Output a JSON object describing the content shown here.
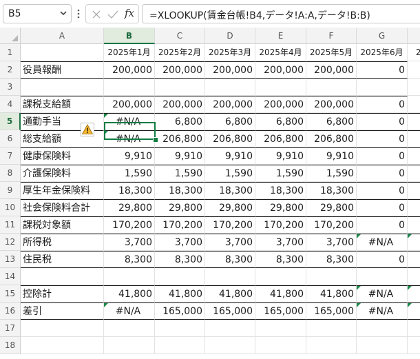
{
  "name_box": {
    "value": "B5"
  },
  "formula_bar": {
    "fx_label": "fx",
    "formula": "=XLOOKUP(賃金台帳!B4,データ!A:A,データ!B:B)"
  },
  "sheet": {
    "columns": [
      "A",
      "B",
      "C",
      "D",
      "E",
      "F",
      "G"
    ],
    "rows": [
      "1",
      "2",
      "3",
      "4",
      "5",
      "6",
      "7",
      "8",
      "9",
      "10",
      "11",
      "12",
      "13",
      "14",
      "15",
      "16",
      "17",
      "18"
    ],
    "header_row": [
      "",
      "2025年1月",
      "2025年2月",
      "2025年3月",
      "2025年4月",
      "2025年5月",
      "2025年6月",
      "20"
    ],
    "data": [
      [
        "役員報酬",
        "200,000",
        "200,000",
        "200,000",
        "200,000",
        "200,000",
        "0"
      ],
      [
        "",
        "",
        "",
        "",
        "",
        "",
        ""
      ],
      [
        "課税支給額",
        "200,000",
        "200,000",
        "200,000",
        "200,000",
        "200,000",
        "0"
      ],
      [
        "通勤手当",
        "#N/A",
        "6,800",
        "6,800",
        "6,800",
        "6,800",
        "0"
      ],
      [
        "総支給額",
        "#N/A",
        "206,800",
        "206,800",
        "206,800",
        "206,800",
        "0"
      ],
      [
        "健康保険料",
        "9,910",
        "9,910",
        "9,910",
        "9,910",
        "9,910",
        "0"
      ],
      [
        "介護保険料",
        "1,590",
        "1,590",
        "1,590",
        "1,590",
        "1,590",
        "0"
      ],
      [
        "厚生年金保険料",
        "18,300",
        "18,300",
        "18,300",
        "18,300",
        "18,300",
        "0"
      ],
      [
        "社会保険料合計",
        "29,800",
        "29,800",
        "29,800",
        "29,800",
        "29,800",
        "0"
      ],
      [
        "課税対象額",
        "170,200",
        "170,200",
        "170,200",
        "170,200",
        "170,200",
        "0"
      ],
      [
        "所得税",
        "3,700",
        "3,700",
        "3,700",
        "3,700",
        "3,700",
        "#N/A"
      ],
      [
        "住民税",
        "8,300",
        "8,300",
        "8,300",
        "8,300",
        "8,300",
        "0"
      ],
      [
        "",
        "",
        "",
        "",
        "",
        "",
        ""
      ],
      [
        "控除計",
        "41,800",
        "41,800",
        "41,800",
        "41,800",
        "41,800",
        "#N/A"
      ],
      [
        "差引",
        "#N/A",
        "165,000",
        "165,000",
        "165,000",
        "165,000",
        "#N/A"
      ],
      [
        "",
        "",
        "",
        "",
        "",
        "",
        ""
      ],
      [
        "",
        "",
        "",
        "",
        "",
        "",
        ""
      ]
    ],
    "partial_column": [
      "0",
      "",
      "0",
      "0",
      "0",
      "0",
      "0",
      "0",
      "0",
      "0",
      "#",
      "0",
      "",
      "#",
      "#",
      "",
      ""
    ],
    "selected_cell": "B5"
  },
  "icons": {
    "warning": "warning-icon",
    "cancel": "cancel-x-icon",
    "confirm": "confirm-check-icon"
  },
  "colors": {
    "accent": "#107c41",
    "error_flag": "#1f8a4c",
    "warning": "#f2b632"
  }
}
